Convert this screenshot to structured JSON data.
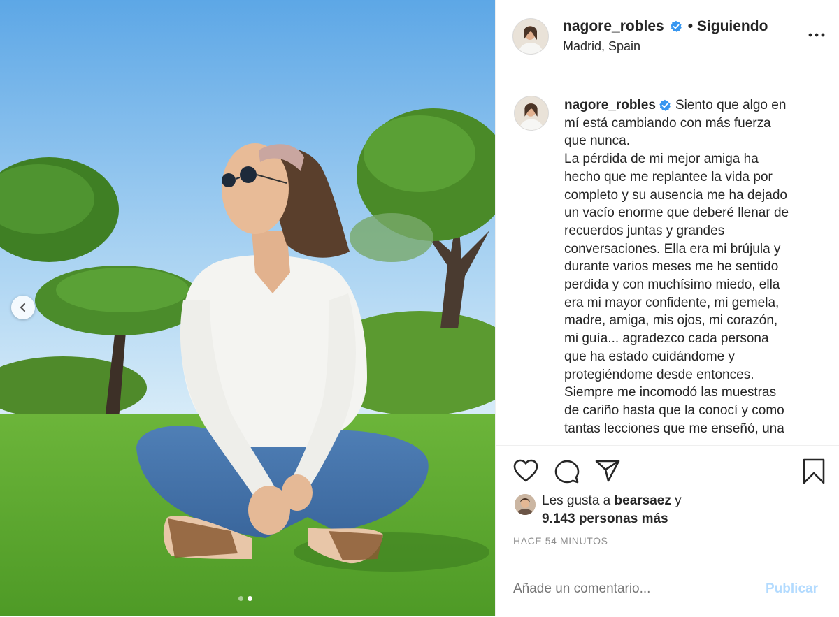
{
  "post": {
    "username": "nagore_robles",
    "follow_status": "• Siguiendo",
    "location": "Madrid, Spain",
    "caption_lines": [
      "Siento que algo en",
      "mí está cambiando con más fuerza",
      "que nunca.",
      "La pérdida de mi mejor amiga ha",
      "hecho que me replantee la vida por",
      "completo y su ausencia me ha dejado",
      "un vacío enorme que deberé llenar de",
      "recuerdos juntas y grandes",
      "conversaciones. Ella era mi brújula y",
      "durante varios meses me he sentido",
      "perdida y con muchísimo miedo, ella",
      "era mi mayor confidente, mi gemela,",
      "madre, amiga, mis ojos, mi corazón,",
      "mi guía... agradezco cada persona",
      "que ha estado cuidándome y",
      "protegiéndome desde entonces.",
      "Siempre me incomodó las muestras",
      "de cariño hasta que la conocí y como",
      "tantas lecciones que me enseñó, una"
    ],
    "likes_prefix": "Les gusta a",
    "likes_user": "bearsaez",
    "likes_conj": "y",
    "likes_others": "9.143 personas más",
    "timestamp": "HACE 54 MINUTOS",
    "comment_placeholder": "Añade un comentario...",
    "publish_label": "Publicar"
  },
  "carousel": {
    "current_index": 2,
    "total": 2
  },
  "icons": [
    "more-options-icon",
    "heart-icon",
    "comment-icon",
    "share-icon",
    "bookmark-icon",
    "verified-badge-icon",
    "chevron-left-icon"
  ],
  "colors": {
    "verified": "#3897f0",
    "publish_disabled": "#b3dbff",
    "text": "#262626",
    "muted": "#8e8e8e"
  }
}
